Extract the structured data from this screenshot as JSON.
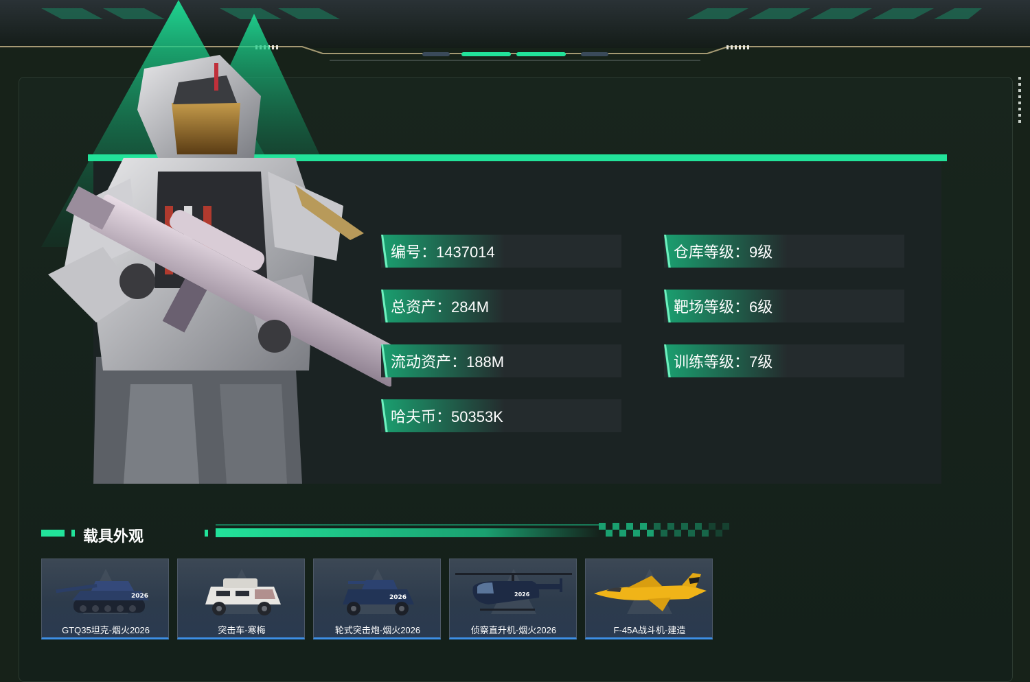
{
  "stats": [
    {
      "label": "编号",
      "value": "1437014"
    },
    {
      "label": "仓库等级",
      "value": "9级"
    },
    {
      "label": "总资产",
      "value": "284M"
    },
    {
      "label": "靶场等级",
      "value": "6级"
    },
    {
      "label": "流动资产",
      "value": "188M"
    },
    {
      "label": "训练等级",
      "value": "7级"
    },
    {
      "label": "哈夫币",
      "value": "50353K"
    }
  ],
  "stat_text": [
    "编号：1437014",
    "仓库等级：9级",
    "总资产：284M",
    "靶场等级：6级",
    "流动资产：188M",
    "训练等级：7级",
    "哈夫币：50353K"
  ],
  "vehicle_section": {
    "title": "载具外观"
  },
  "vehicles": [
    {
      "name": "GTQ35坦克-烟火2026",
      "icon": "tank-icon"
    },
    {
      "name": "突击车-寒梅",
      "icon": "assault-vehicle-icon"
    },
    {
      "name": "轮式突击炮-烟火2026",
      "icon": "wheeled-assault-gun-icon"
    },
    {
      "name": "侦察直升机-烟火2026",
      "icon": "helicopter-icon"
    },
    {
      "name": "F-45A战斗机-建造",
      "icon": "fighter-jet-icon"
    }
  ],
  "colors": {
    "accent": "#22e39a",
    "card_border": "#3d8fe6",
    "background": "#172219"
  }
}
